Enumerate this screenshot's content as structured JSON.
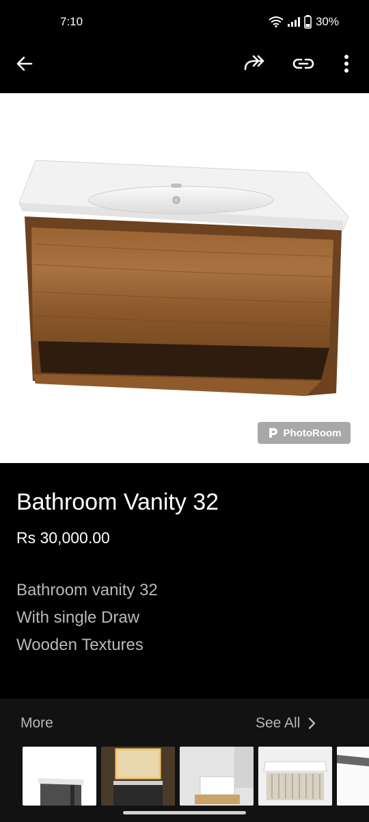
{
  "status_bar": {
    "time": "7:10",
    "battery": "30%"
  },
  "top_bar": {
    "back_icon": "arrow-left-icon",
    "share_icon": "share-forward-icon",
    "link_icon": "link-icon",
    "more_icon": "more-vertical-icon"
  },
  "hero": {
    "watermark": "PhotoRoom"
  },
  "product": {
    "title": "Bathroom Vanity 32",
    "price": "Rs 30,000.00",
    "description": [
      "Bathroom vanity 32",
      "With single Draw",
      "Wooden Textures"
    ]
  },
  "more": {
    "label": "More",
    "see_all": "See All"
  },
  "colors": {
    "background": "#000000",
    "panel": "#121212",
    "wood": "#8a5a2e",
    "muted_text": "#b9b9b9"
  }
}
